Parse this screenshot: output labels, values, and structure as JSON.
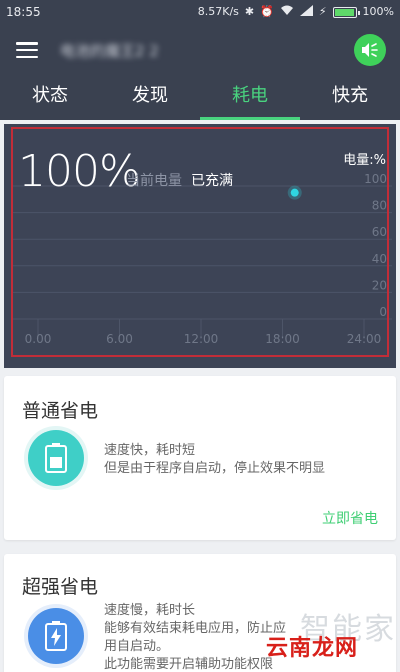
{
  "status_bar": {
    "time": "18:55",
    "speed": "8.57K/s",
    "battery_text": "100%",
    "battery_level": 1.0
  },
  "app_bar": {
    "title": "电池的魔王2 2"
  },
  "tabs": [
    {
      "label": "状态",
      "active": false
    },
    {
      "label": "发现",
      "active": false
    },
    {
      "label": "耗电",
      "active": true
    },
    {
      "label": "快充",
      "active": false
    }
  ],
  "battery_panel": {
    "percent_text": "100%",
    "current_label": "当前电量",
    "current_status": "已充满",
    "unit_label": "电量:%"
  },
  "chart_data": {
    "type": "scatter",
    "x_ticks": [
      "0.00",
      "6.00",
      "12:00",
      "18:00",
      "24:00"
    ],
    "y_ticks": [
      "100",
      "80",
      "60",
      "40",
      "20",
      "0"
    ],
    "xlim": [
      0,
      24
    ],
    "ylim": [
      0,
      100
    ],
    "points": [
      {
        "x": 18.9,
        "y": 95
      }
    ],
    "point_color": "#2fd7e2",
    "grid": true
  },
  "cards": [
    {
      "title": "普通省电",
      "lines": [
        "速度快，耗时短",
        "但是由于程序自启动，停止效果不明显"
      ],
      "action": "立即省电",
      "icon_color": "#3fcfc7"
    },
    {
      "title": "超强省电",
      "lines": [
        "速度慢，耗时长",
        "能够有效结束耗电应用，防止应",
        "用自启动。",
        "此功能需要开启辅助功能权限"
      ],
      "icon_color": "#4a8ee6"
    }
  ],
  "watermarks": {
    "line1": "智能家",
    "line2": "云南龙网"
  },
  "colors": {
    "accent": "#49d37f",
    "header_bg": "#3a4150",
    "panel_bg": "#3d4456",
    "highlight_border": "#c22d38"
  }
}
